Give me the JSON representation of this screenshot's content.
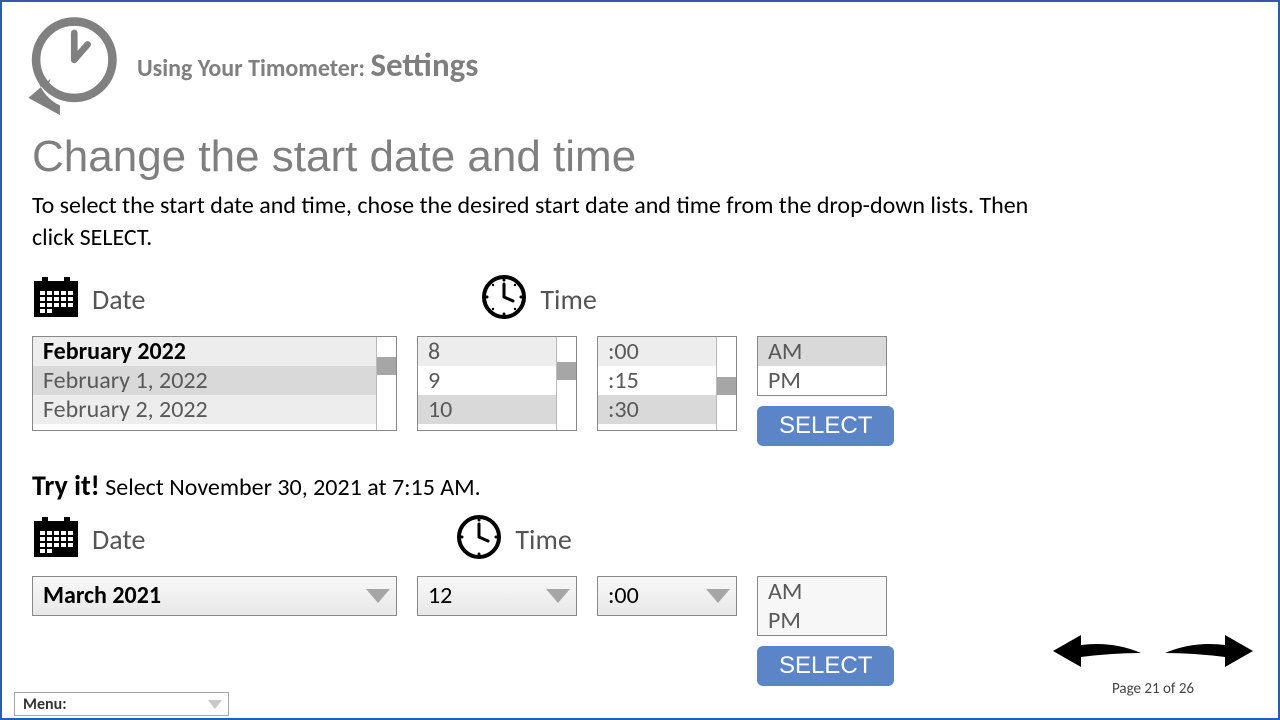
{
  "header": {
    "prefix": "Using Your Timometer: ",
    "section": "Settings"
  },
  "title": "Change the start date and time",
  "instruction": "To select the start date and time, chose the desired start date and time from the drop-down lists. Then click SELECT.",
  "labels": {
    "date": "Date",
    "time": "Time"
  },
  "example": {
    "date_items": [
      "February 2022",
      "February 1, 2022",
      "February 2, 2022"
    ],
    "hour_items": [
      "8",
      "9",
      "10"
    ],
    "minute_items": [
      ":00",
      ":15",
      ":30"
    ],
    "ampm_items": [
      "AM",
      "PM"
    ],
    "select_btn": "SELECT"
  },
  "tryit": {
    "label": "Try it!",
    "text": " Select November 30, 2021 at 7:15 AM.",
    "date_value": "March 2021",
    "hour_value": "12",
    "minute_value": ":00",
    "ampm_items": [
      "AM",
      "PM"
    ],
    "select_btn": "SELECT"
  },
  "pager": {
    "text": "Page 21 of 26"
  },
  "menu": {
    "label": "Menu:"
  }
}
